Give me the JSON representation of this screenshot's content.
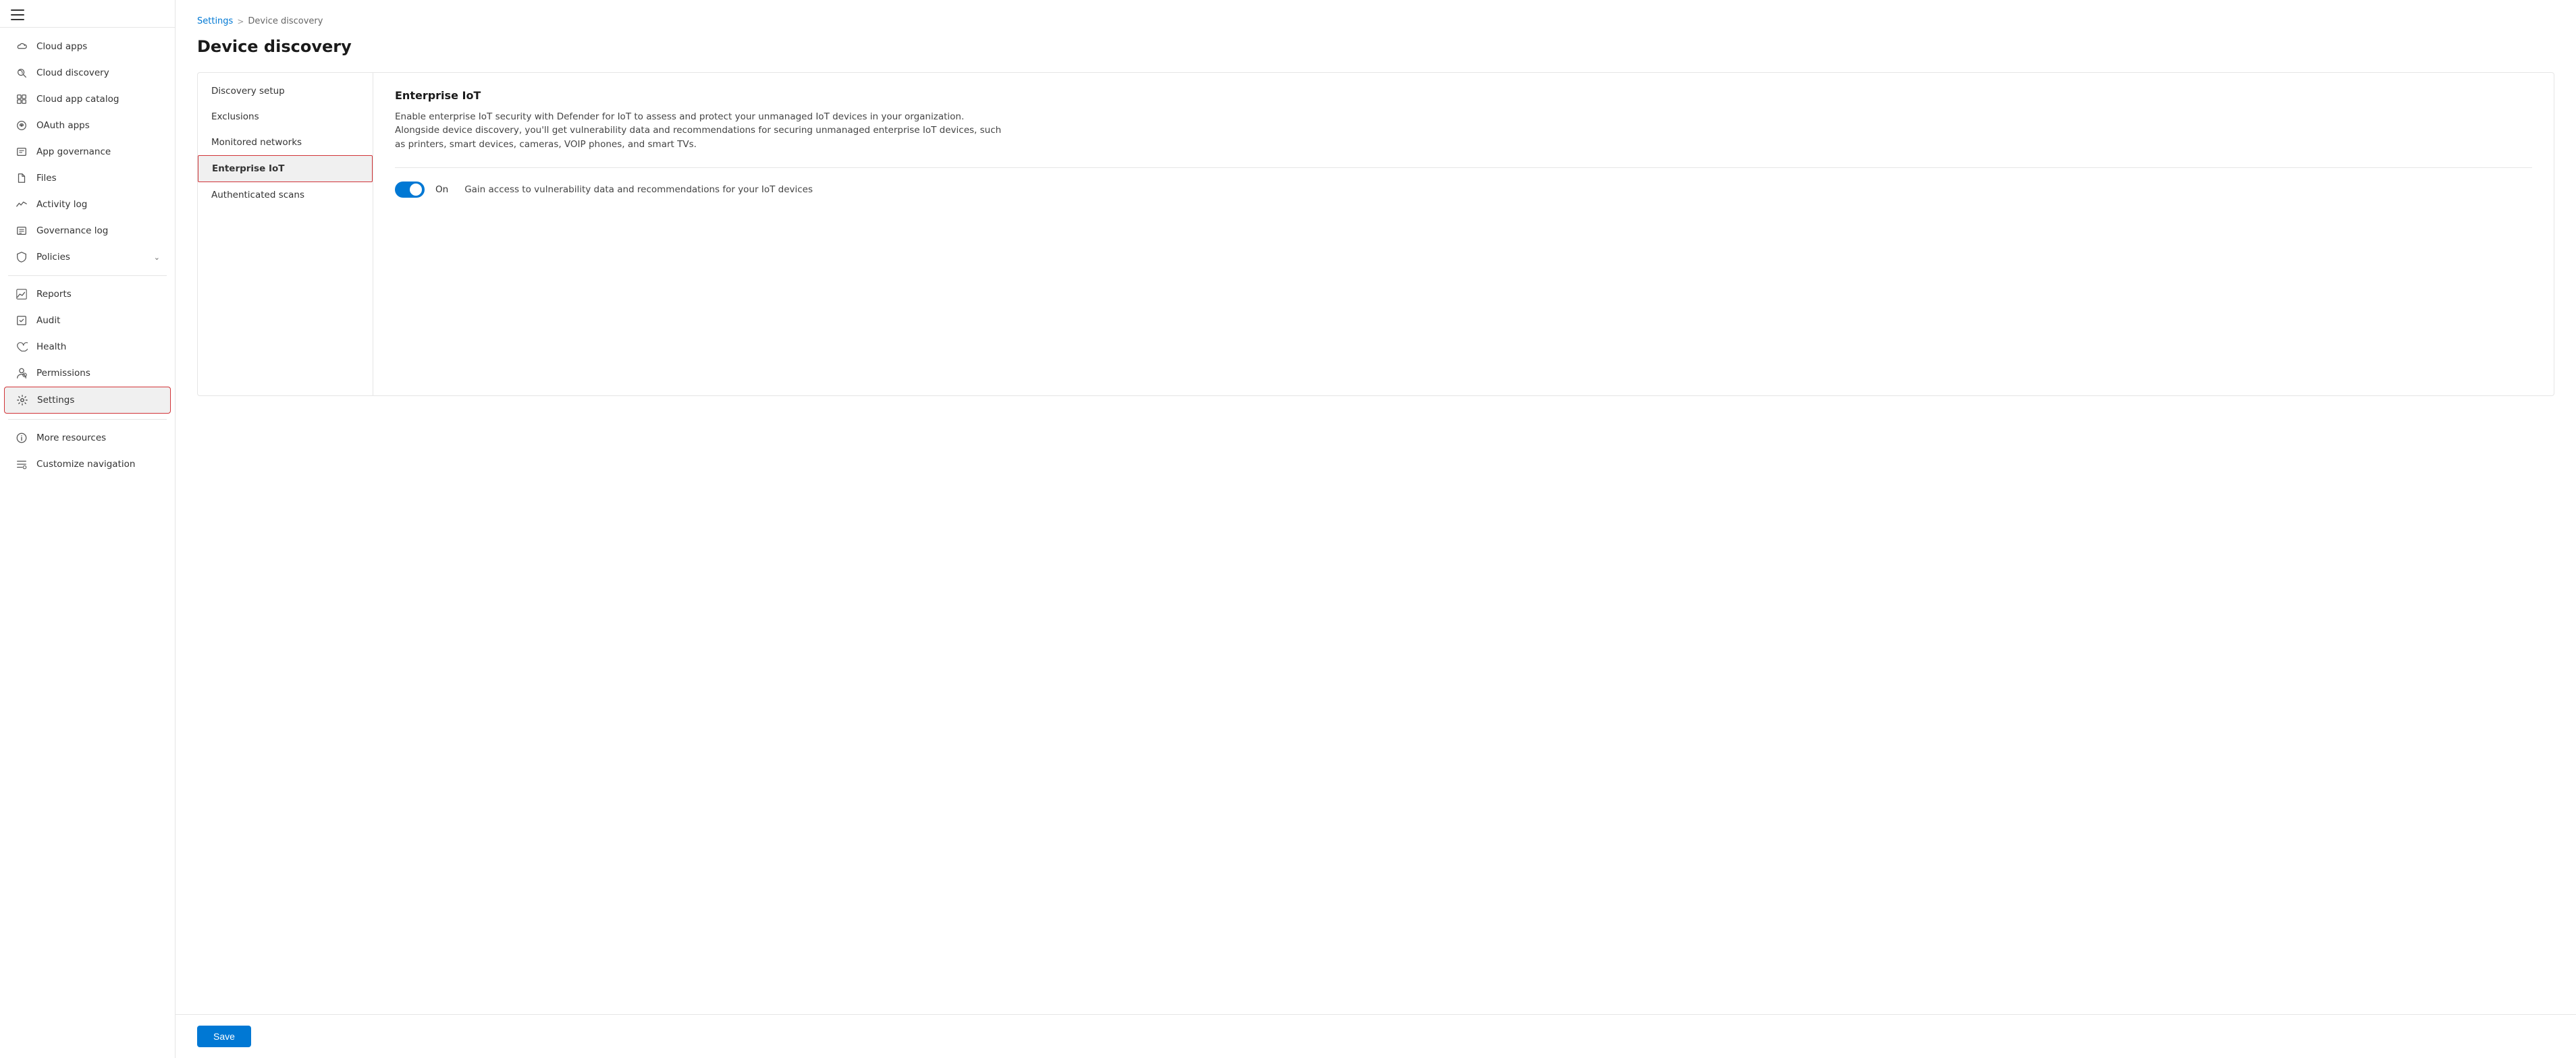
{
  "sidebar": {
    "hamburger_label": "Menu",
    "items": [
      {
        "id": "cloud-apps",
        "label": "Cloud apps",
        "icon": "cloud-apps"
      },
      {
        "id": "cloud-discovery",
        "label": "Cloud discovery",
        "icon": "cloud-discovery"
      },
      {
        "id": "cloud-app-catalog",
        "label": "Cloud app catalog",
        "icon": "catalog"
      },
      {
        "id": "oauth-apps",
        "label": "OAuth apps",
        "icon": "oauth"
      },
      {
        "id": "app-governance",
        "label": "App governance",
        "icon": "app-governance"
      },
      {
        "id": "files",
        "label": "Files",
        "icon": "files"
      },
      {
        "id": "activity-log",
        "label": "Activity log",
        "icon": "activity"
      },
      {
        "id": "governance-log",
        "label": "Governance log",
        "icon": "governance"
      },
      {
        "id": "policies",
        "label": "Policies",
        "icon": "policies",
        "has_chevron": true
      }
    ],
    "items2": [
      {
        "id": "reports",
        "label": "Reports",
        "icon": "reports"
      },
      {
        "id": "audit",
        "label": "Audit",
        "icon": "audit"
      },
      {
        "id": "health",
        "label": "Health",
        "icon": "health"
      },
      {
        "id": "permissions",
        "label": "Permissions",
        "icon": "permissions"
      },
      {
        "id": "settings",
        "label": "Settings",
        "icon": "settings",
        "active": true
      }
    ],
    "items3": [
      {
        "id": "more-resources",
        "label": "More resources",
        "icon": "more-resources"
      },
      {
        "id": "customize-navigation",
        "label": "Customize navigation",
        "icon": "customize"
      }
    ]
  },
  "breadcrumb": {
    "parent": "Settings",
    "separator": ">",
    "current": "Device discovery"
  },
  "page": {
    "title": "Device discovery"
  },
  "settings_nav": [
    {
      "id": "discovery-setup",
      "label": "Discovery setup"
    },
    {
      "id": "exclusions",
      "label": "Exclusions"
    },
    {
      "id": "monitored-networks",
      "label": "Monitored networks"
    },
    {
      "id": "enterprise-iot",
      "label": "Enterprise IoT",
      "active": true
    },
    {
      "id": "authenticated-scans",
      "label": "Authenticated scans"
    }
  ],
  "enterprise_iot": {
    "title": "Enterprise IoT",
    "description": "Enable enterprise IoT security with Defender for IoT to assess and protect your unmanaged IoT devices in your organization. Alongside device discovery, you'll get vulnerability data and recommendations for securing unmanaged enterprise IoT devices, such as printers, smart devices, cameras, VOIP phones, and smart TVs.",
    "toggle": {
      "state": "on",
      "label": "On",
      "description": "Gain access to vulnerability data and recommendations for your IoT devices"
    }
  },
  "buttons": {
    "save": "Save"
  }
}
